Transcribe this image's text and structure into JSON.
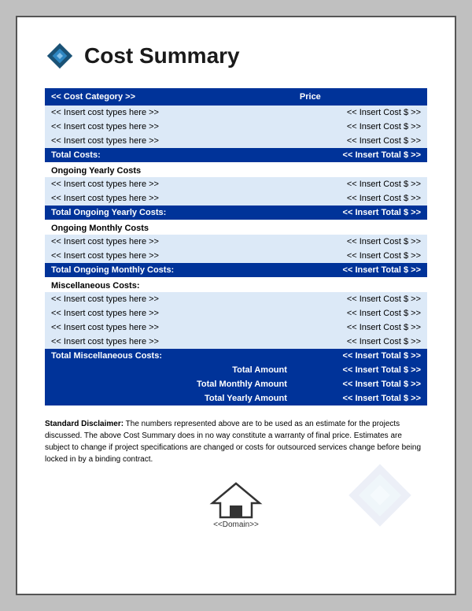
{
  "header": {
    "title": "Cost Summary"
  },
  "table": {
    "col_category": "<< Cost Category >>",
    "col_price": "Price",
    "sections": [
      {
        "type": "initial",
        "rows": [
          {
            "category": "<< Insert cost types here >>",
            "price": "<< Insert Cost $ >>"
          },
          {
            "category": "<< Insert cost types here >>",
            "price": "<< Insert Cost $ >>"
          },
          {
            "category": "<< Insert cost types here >>",
            "price": "<< Insert Cost $ >>"
          }
        ],
        "total_label": "Total Costs:",
        "total_value": "<< Insert Total $ >>"
      },
      {
        "type": "ongoing_yearly",
        "section_header": "Ongoing Yearly Costs",
        "rows": [
          {
            "category": "<< Insert cost types here >>",
            "price": "<< Insert Cost $ >>"
          },
          {
            "category": "<< Insert cost types here >>",
            "price": "<< Insert Cost $ >>"
          }
        ],
        "total_label": "Total Ongoing Yearly Costs:",
        "total_value": "<< Insert Total $ >>"
      },
      {
        "type": "ongoing_monthly",
        "section_header": "Ongoing Monthly Costs",
        "rows": [
          {
            "category": "<< Insert cost types here >>",
            "price": "<< Insert Cost $ >>"
          },
          {
            "category": "<< Insert cost types here >>",
            "price": "<< Insert Cost $ >>"
          }
        ],
        "total_label": "Total Ongoing Monthly Costs:",
        "total_value": "<< Insert Total $ >>"
      },
      {
        "type": "miscellaneous",
        "section_header": "Miscellaneous Costs:",
        "rows": [
          {
            "category": "<< Insert cost types here >>",
            "price": "<< Insert Cost $ >>"
          },
          {
            "category": "<< Insert cost types here >>",
            "price": "<< Insert Cost $ >>"
          },
          {
            "category": "<< Insert cost types here >>",
            "price": "<< Insert Cost $ >>"
          },
          {
            "category": "<< Insert cost types here >>",
            "price": "<< Insert Cost $ >>"
          }
        ],
        "total_label": "Total Miscellaneous Costs:",
        "total_value": "<< Insert Total $ >>"
      }
    ],
    "summary": [
      {
        "label": "Total Amount",
        "value": "<< Insert Total $ >>"
      },
      {
        "label": "Total Monthly Amount",
        "value": "<< Insert Total $ >>"
      },
      {
        "label": "Total Yearly Amount",
        "value": "<< Insert Total $ >>"
      }
    ]
  },
  "disclaimer": {
    "bold": "Standard Disclaimer:",
    "text": " The numbers represented above are to be used as an estimate for the projects discussed. The above Cost Summary does in no way constitute a warranty of final price. Estimates are subject to change if project specifications are changed or costs for outsourced services change before being locked in by a binding contract."
  },
  "footer": {
    "domain": "<<Domain>>"
  }
}
